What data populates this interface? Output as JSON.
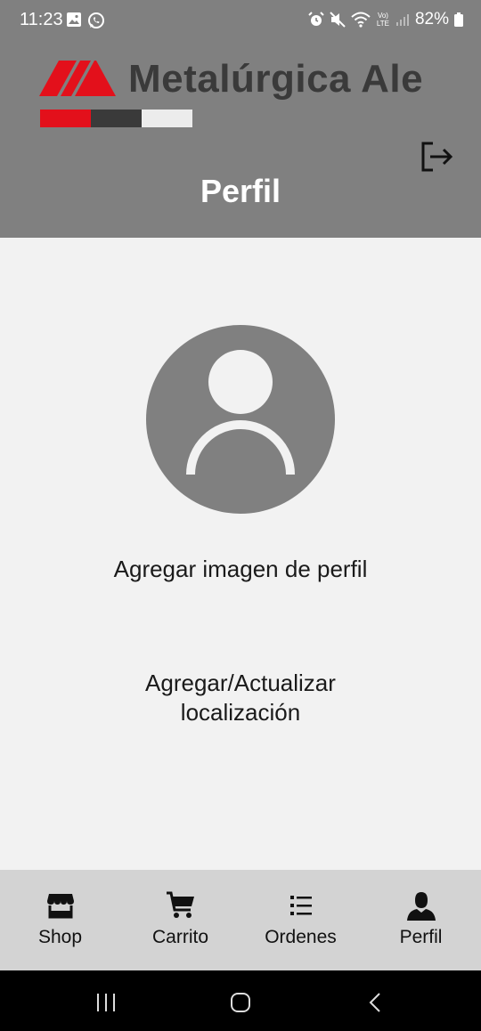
{
  "status_bar": {
    "time": "11:23",
    "battery": "82%",
    "network": "Vo) LTE"
  },
  "header": {
    "brand_name": "Metalúrgica Ale",
    "title": "Perfil",
    "logout_icon": "logout-icon"
  },
  "profile": {
    "avatar_icon": "person-icon",
    "add_image_label": "Agregar imagen de perfil",
    "location_label": "Agregar/Actualizar localización"
  },
  "bottom_nav": {
    "items": [
      {
        "label": "Shop",
        "icon": "store-icon"
      },
      {
        "label": "Carrito",
        "icon": "cart-icon"
      },
      {
        "label": "Ordenes",
        "icon": "list-icon"
      },
      {
        "label": "Perfil",
        "icon": "person-icon"
      }
    ]
  },
  "colors": {
    "header_bg": "#808080",
    "page_bg": "#f2f2f2",
    "nav_bg": "#d3d3d3",
    "brand_red": "#e3101b",
    "brand_dark": "#3a3a3a"
  }
}
